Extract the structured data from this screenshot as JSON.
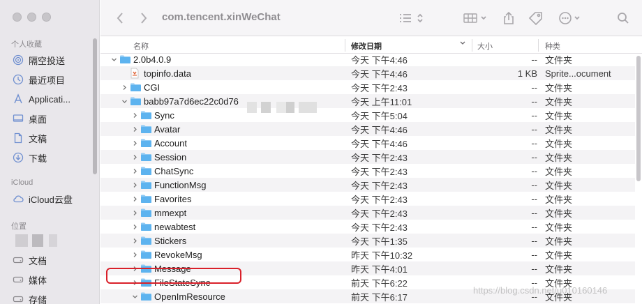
{
  "window": {
    "title": "com.tencent.xinWeChat"
  },
  "sidebar": {
    "favorites_title": "个人收藏",
    "favorites": [
      {
        "label": "隔空投送",
        "icon": "airdrop-icon"
      },
      {
        "label": "最近项目",
        "icon": "clock-icon"
      },
      {
        "label": "Applicati...",
        "icon": "applications-icon"
      },
      {
        "label": "桌面",
        "icon": "desktop-icon"
      },
      {
        "label": "文稿",
        "icon": "document-icon"
      },
      {
        "label": "下载",
        "icon": "download-icon"
      }
    ],
    "icloud_title": "iCloud",
    "icloud": [
      {
        "label": "iCloud云盘",
        "icon": "cloud-icon"
      }
    ],
    "locations_title": "位置",
    "locations": [
      {
        "label": "文档",
        "icon": "disk-icon"
      },
      {
        "label": "媒体",
        "icon": "disk-icon"
      },
      {
        "label": "存储",
        "icon": "disk-icon"
      }
    ]
  },
  "columns": {
    "name": "名称",
    "date": "修改日期",
    "size": "大小",
    "kind": "种类"
  },
  "rows": [
    {
      "name": "2.0b4.0.9",
      "date": "今天 下午4:46",
      "size": "--",
      "kind": "文件夹",
      "type": "folder",
      "level": 0,
      "expanded": true
    },
    {
      "name": "topinfo.data",
      "date": "今天 下午4:46",
      "size": "1 KB",
      "kind": "Sprite...ocument",
      "type": "file",
      "level": 1
    },
    {
      "name": "CGI",
      "date": "今天 下午2:43",
      "size": "--",
      "kind": "文件夹",
      "type": "folder",
      "level": 1,
      "expanded": false
    },
    {
      "name": "babb97a7d6ec22c0d76",
      "date": "今天 上午11:01",
      "size": "--",
      "kind": "文件夹",
      "type": "folder",
      "level": 1,
      "expanded": true
    },
    {
      "name": "Sync",
      "date": "今天 下午5:04",
      "size": "--",
      "kind": "文件夹",
      "type": "folder",
      "level": 2,
      "expanded": false
    },
    {
      "name": "Avatar",
      "date": "今天 下午4:46",
      "size": "--",
      "kind": "文件夹",
      "type": "folder",
      "level": 2,
      "expanded": false
    },
    {
      "name": "Account",
      "date": "今天 下午4:46",
      "size": "--",
      "kind": "文件夹",
      "type": "folder",
      "level": 2,
      "expanded": false
    },
    {
      "name": "Session",
      "date": "今天 下午2:43",
      "size": "--",
      "kind": "文件夹",
      "type": "folder",
      "level": 2,
      "expanded": false
    },
    {
      "name": "ChatSync",
      "date": "今天 下午2:43",
      "size": "--",
      "kind": "文件夹",
      "type": "folder",
      "level": 2,
      "expanded": false
    },
    {
      "name": "FunctionMsg",
      "date": "今天 下午2:43",
      "size": "--",
      "kind": "文件夹",
      "type": "folder",
      "level": 2,
      "expanded": false
    },
    {
      "name": "Favorites",
      "date": "今天 下午2:43",
      "size": "--",
      "kind": "文件夹",
      "type": "folder",
      "level": 2,
      "expanded": false
    },
    {
      "name": "mmexpt",
      "date": "今天 下午2:43",
      "size": "--",
      "kind": "文件夹",
      "type": "folder",
      "level": 2,
      "expanded": false
    },
    {
      "name": "newabtest",
      "date": "今天 下午2:43",
      "size": "--",
      "kind": "文件夹",
      "type": "folder",
      "level": 2,
      "expanded": false
    },
    {
      "name": "Stickers",
      "date": "今天 下午1:35",
      "size": "--",
      "kind": "文件夹",
      "type": "folder",
      "level": 2,
      "expanded": false
    },
    {
      "name": "RevokeMsg",
      "date": "昨天 下午10:32",
      "size": "--",
      "kind": "文件夹",
      "type": "folder",
      "level": 2,
      "expanded": false
    },
    {
      "name": "Message",
      "date": "昨天 下午4:01",
      "size": "--",
      "kind": "文件夹",
      "type": "folder",
      "level": 2,
      "expanded": false
    },
    {
      "name": "FileStateSync",
      "date": "前天 下午6:22",
      "size": "--",
      "kind": "文件夹",
      "type": "folder",
      "level": 2,
      "expanded": false
    },
    {
      "name": "OpenImResource",
      "date": "前天 下午6:17",
      "size": "--",
      "kind": "文件夹",
      "type": "folder",
      "level": 2,
      "expanded": true
    }
  ],
  "watermark": "https://blog.csdn.net/u010160146",
  "colors": {
    "folder": "#5db3ef",
    "folder_tab": "#8fcaf4",
    "highlight": "#d9202a"
  }
}
